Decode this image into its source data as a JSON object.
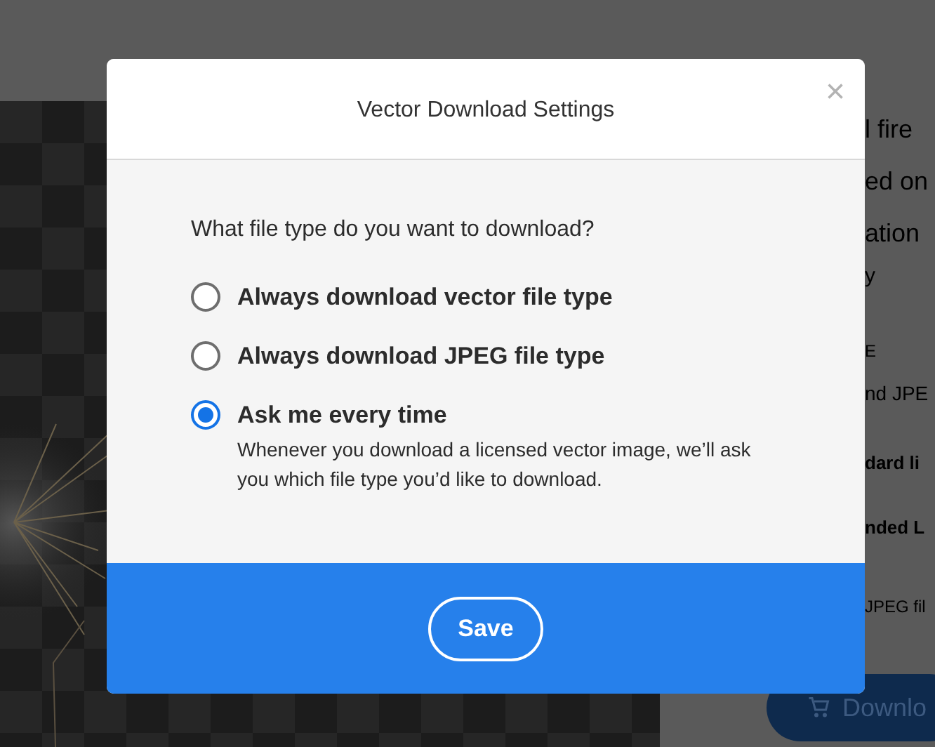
{
  "background": {
    "texts": [
      {
        "text": "l fire",
        "kind": "heading"
      },
      {
        "text": "ed on",
        "kind": "heading"
      },
      {
        "text": "ation",
        "kind": "heading"
      },
      {
        "text": "y",
        "kind": "link"
      },
      {
        "text": "E",
        "kind": "small"
      },
      {
        "text": "nd JPE",
        "kind": "body"
      },
      {
        "text": "dard li",
        "kind": "bold"
      },
      {
        "text": "nded L",
        "kind": "bold"
      },
      {
        "text": "JPEG fil",
        "kind": "small"
      }
    ],
    "download_button": {
      "label": "Downlo"
    }
  },
  "dialog": {
    "title": "Vector Download Settings",
    "close": "×",
    "question": "What file type do you want to download?",
    "options": [
      {
        "label": "Always download vector file type",
        "selected": false
      },
      {
        "label": "Always download JPEG file type",
        "selected": false
      },
      {
        "label": "Ask me every time",
        "selected": true,
        "description": "Whenever you download a licensed vector image, we’ll ask you which file type you’d like to download."
      }
    ],
    "save_button": "Save"
  }
}
